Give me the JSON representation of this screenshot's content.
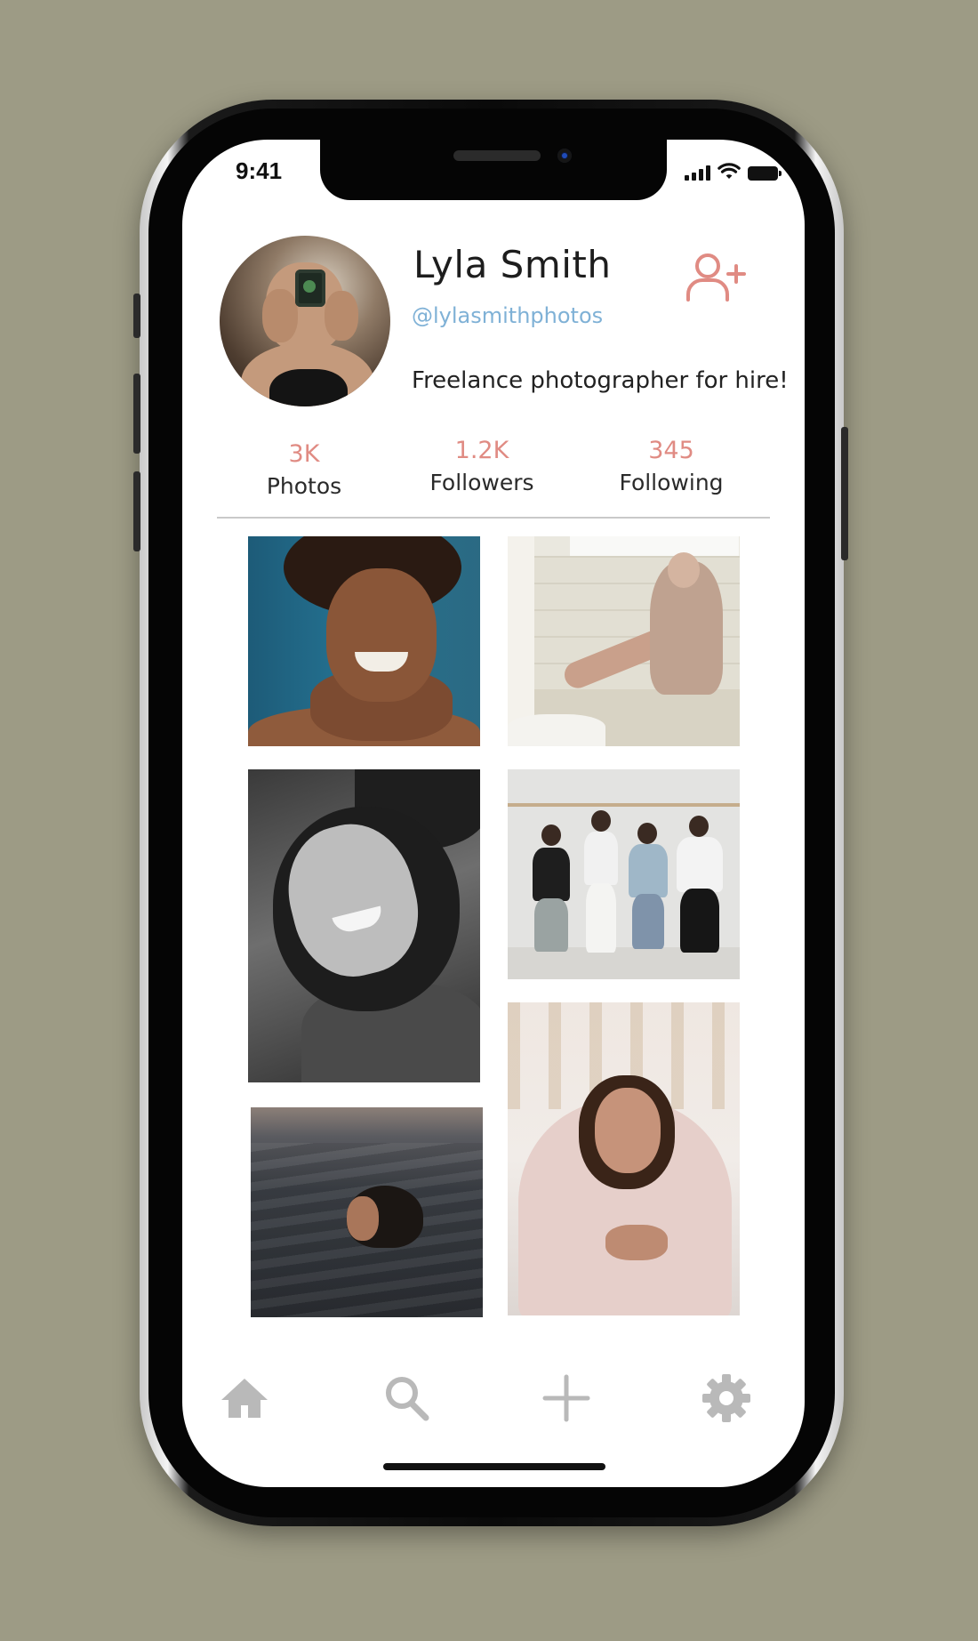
{
  "status_bar": {
    "time": "9:41",
    "icons": [
      "signal-icon",
      "wifi-icon",
      "battery-icon"
    ]
  },
  "profile": {
    "name": "Lyla Smith",
    "handle": "@lylasmithphotos",
    "bio": "Freelance photographer for hire!",
    "follow_icon": "add-user-icon",
    "avatar_alt": "avatar"
  },
  "stats": [
    {
      "value": "3K",
      "label": "Photos"
    },
    {
      "value": "1.2K",
      "label": "Followers"
    },
    {
      "value": "345",
      "label": "Following"
    }
  ],
  "photos": [
    {
      "name": "photo-smiling-woman-blue-background"
    },
    {
      "name": "photo-woman-sitting-bathroom-ledge"
    },
    {
      "name": "photo-laughing-woman-black-white"
    },
    {
      "name": "photo-four-friends-against-wall"
    },
    {
      "name": "photo-woman-swimming-in-sea"
    },
    {
      "name": "photo-woman-wrapped-in-blanket"
    }
  ],
  "nav": [
    {
      "icon": "home-icon"
    },
    {
      "icon": "search-icon"
    },
    {
      "icon": "plus-icon"
    },
    {
      "icon": "gear-icon"
    }
  ],
  "colors": {
    "background": "#9d9b85",
    "accent": "#e08b83",
    "handle": "#7fb1d6",
    "nav_icon": "#b9b9b9"
  }
}
